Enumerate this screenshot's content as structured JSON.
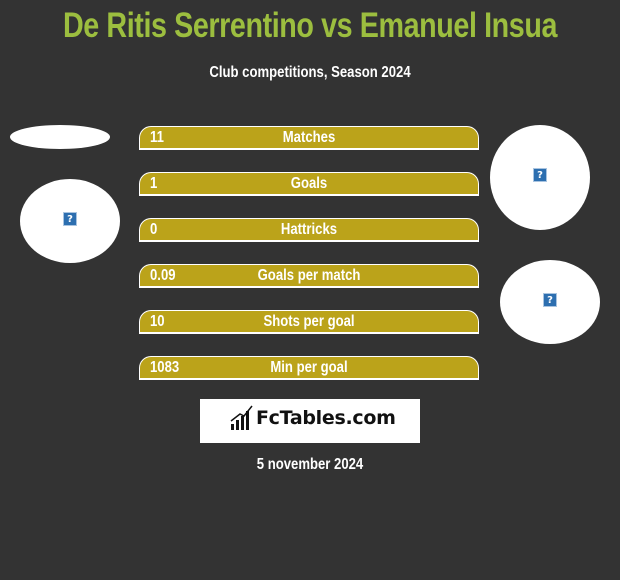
{
  "header": {
    "title": "De Ritis Serrentino vs Emanuel Insua",
    "subtitle": "Club competitions, Season 2024"
  },
  "colors": {
    "background": "#333333",
    "title": "#9cbe3f",
    "bar": "#bba31a",
    "text": "#ffffff"
  },
  "stats": [
    {
      "label": "Matches",
      "value": "11"
    },
    {
      "label": "Goals",
      "value": "1"
    },
    {
      "label": "Hattricks",
      "value": "0"
    },
    {
      "label": "Goals per match",
      "value": "0.09"
    },
    {
      "label": "Shots per goal",
      "value": "10"
    },
    {
      "label": "Min per goal",
      "value": "1083"
    }
  ],
  "images": {
    "placeholder_glyph": "?"
  },
  "logo": {
    "text": "FcTables.com",
    "icon": "bar-chart-icon"
  },
  "footer": {
    "date": "5 november 2024"
  }
}
